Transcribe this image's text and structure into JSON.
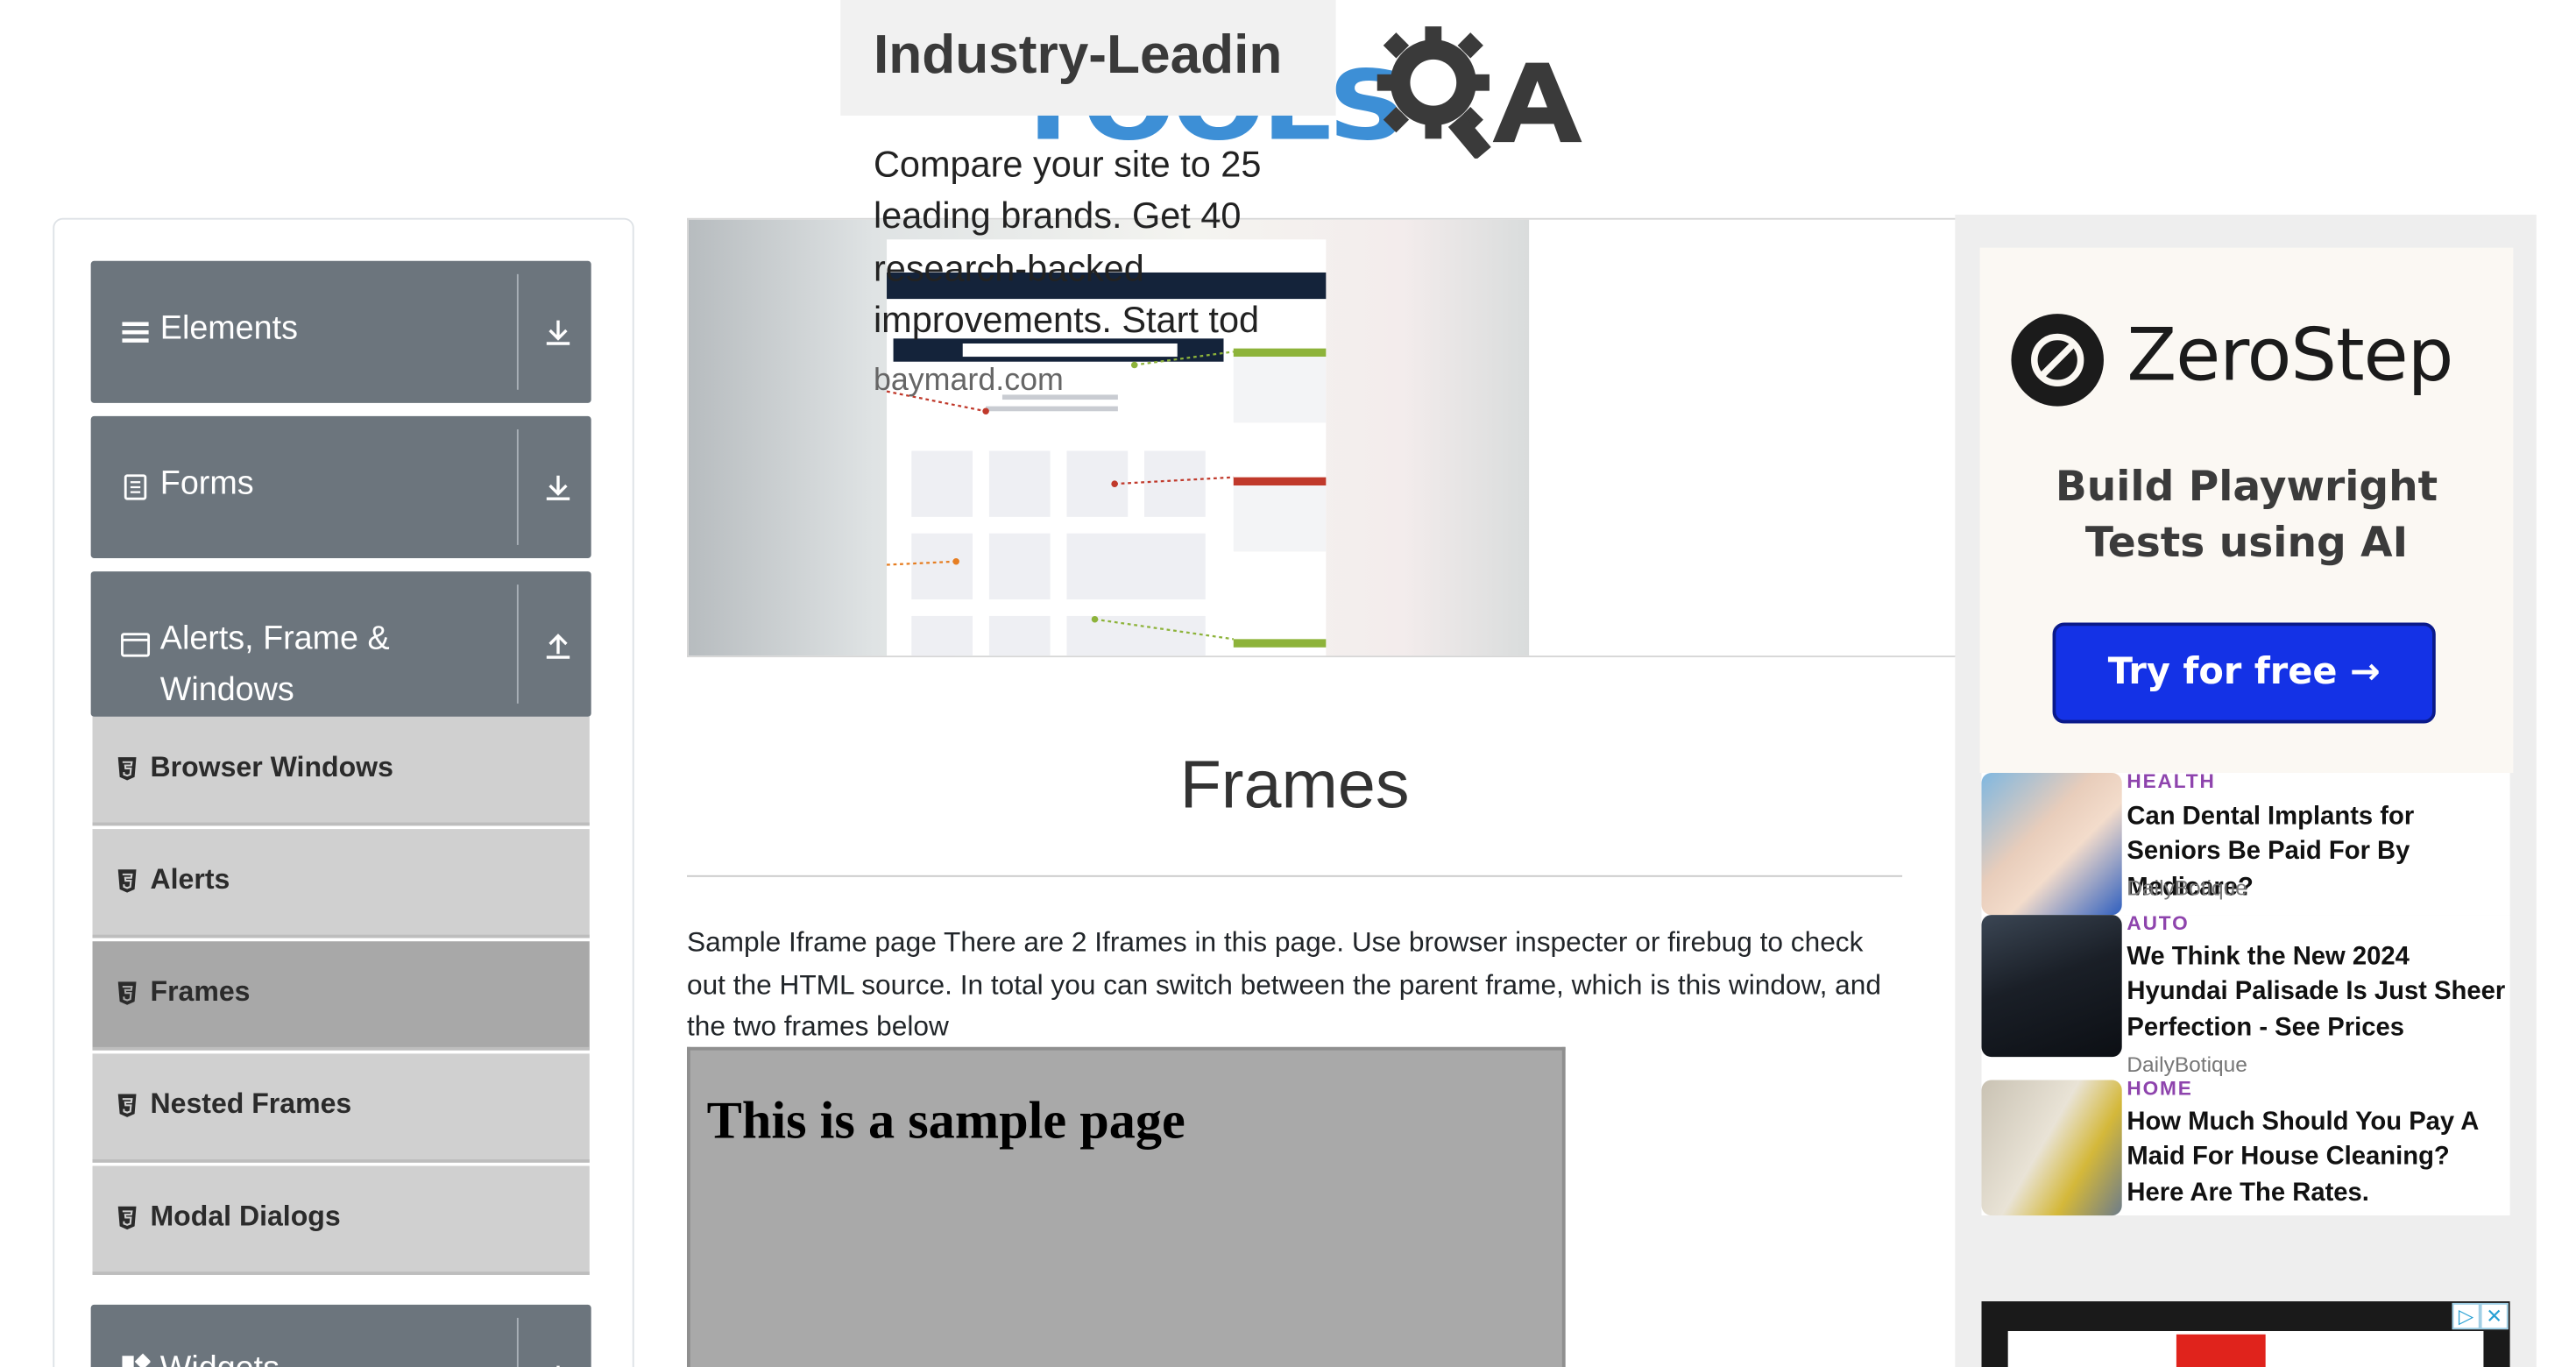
{
  "logo": {
    "text": "TOOLS",
    "letter": "A",
    "color": "#3d8fd6"
  },
  "sidebar": {
    "groups": [
      {
        "label": "Elements",
        "icon": "hamburger-icon",
        "state": "collapsed"
      },
      {
        "label": "Forms",
        "icon": "document-icon",
        "state": "collapsed"
      },
      {
        "label_line1": "Alerts, Frame &",
        "label_line2": "Windows",
        "icon": "window-icon",
        "state": "expanded"
      },
      {
        "label": "Widgets",
        "icon": "widgets-icon",
        "state": "collapsed"
      }
    ],
    "items": [
      {
        "label": "Browser Windows"
      },
      {
        "label": "Alerts"
      },
      {
        "label": "Frames",
        "active": true
      },
      {
        "label": "Nested Frames"
      },
      {
        "label": "Modal Dialogs"
      }
    ]
  },
  "ad_banner": {
    "title": "Industry-Leadin",
    "body_lines": [
      "Compare your site to 25",
      "leading brands. Get 40",
      "research-backed",
      "improvements. Start tod"
    ],
    "domain": "baymard.com"
  },
  "main": {
    "title": "Frames",
    "description": "Sample Iframe page There are 2 Iframes in this page. Use browser inspecter or firebug to check out the HTML source. In total you can switch between the parent frame, which is this window, and the two frames below",
    "iframe_heading": "This is a sample page"
  },
  "side_ad": {
    "brand": "ZeroStep",
    "tagline_line1": "Build Playwright",
    "tagline_line2": "Tests using AI",
    "cta": "Try for free →",
    "news": [
      {
        "category": "HEALTH",
        "title": "Can Dental Implants for Seniors Be Paid For By Medicare?",
        "source": "DailyBotique"
      },
      {
        "category": "AUTO",
        "title": "We Think the New 2024 Hyundai Palisade Is Just Sheer Perfection - See Prices",
        "source": "DailyBotique"
      },
      {
        "category": "HOME",
        "title": "How Much Should You Pay A Maid For House Cleaning? Here Are The Rates.",
        "source": ""
      }
    ]
  },
  "colors": {
    "sidebar_header": "#6c757d",
    "sidebar_item": "#d0d0d0",
    "sidebar_active": "#a8a8a8",
    "cta": "#1432e6",
    "category": "#8e44ad"
  }
}
